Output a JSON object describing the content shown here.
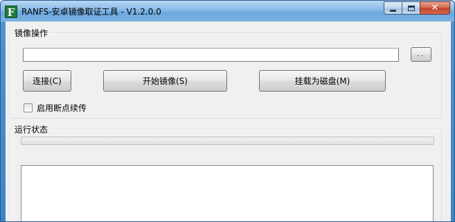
{
  "window": {
    "icon_letter": "F",
    "title": "RANFS-安卓镜像取证工具 - V1.2.0.0",
    "minimize_symbol": "",
    "maximize_symbol": "",
    "close_symbol": "✕"
  },
  "image_group": {
    "legend": "镜像操作",
    "path_value": "",
    "browse_label": "..",
    "connect_label": "连接(C)",
    "start_label": "开始镜像(S)",
    "mount_label": "挂载为磁盘(M)",
    "resume_label": "启用断点续传",
    "resume_checked": false
  },
  "status_group": {
    "legend": "运行状态",
    "progress_fraction": 0.0,
    "log_text": ""
  },
  "colors": {
    "progress_fill": "#37b44a",
    "title_bar": "#8dbde8",
    "app_icon": "#1e7a3a"
  }
}
